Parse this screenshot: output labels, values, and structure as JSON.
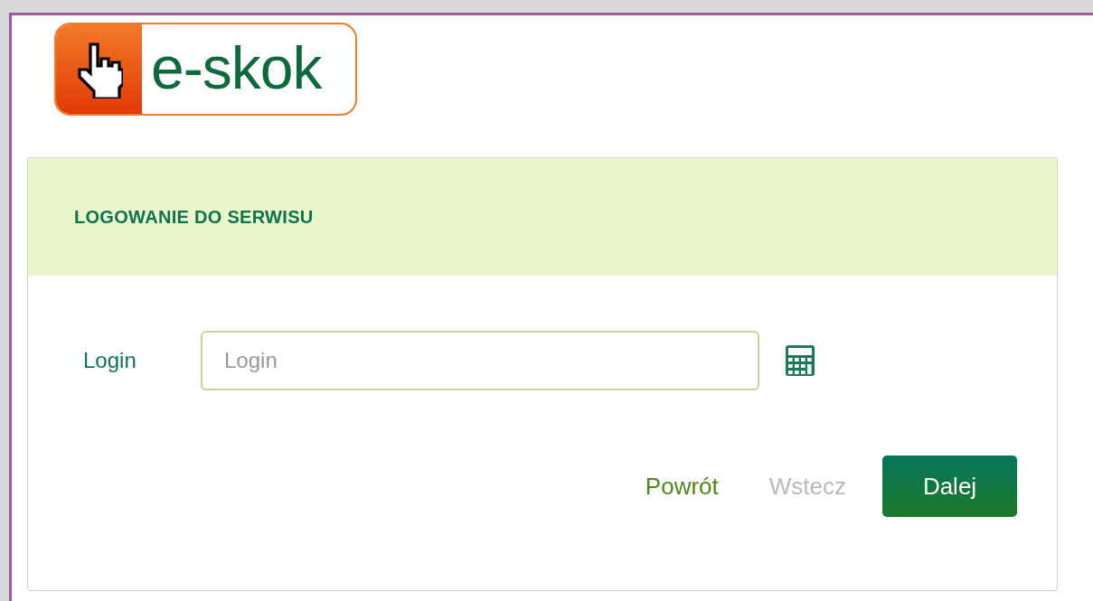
{
  "logo": {
    "text": "e-skok"
  },
  "panel": {
    "title": "LOGOWANIE DO SERWISU",
    "field": {
      "label": "Login",
      "placeholder": "Login"
    },
    "buttons": [
      {
        "label": "Powrót",
        "kind": "link",
        "disabled": false
      },
      {
        "label": "Wstecz",
        "kind": "link",
        "disabled": true
      },
      {
        "label": "Dalej",
        "kind": "primary",
        "disabled": false
      }
    ]
  }
}
